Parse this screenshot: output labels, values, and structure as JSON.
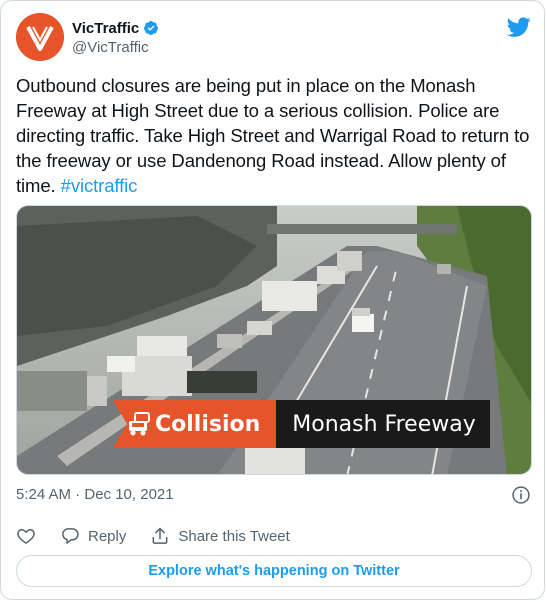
{
  "account": {
    "display_name": "VicTraffic",
    "handle": "@VicTraffic",
    "verified": true,
    "avatar_icon": "victraffic-logo",
    "brand_color": "#e8542a"
  },
  "tweet": {
    "text": "Outbound closures are being put in place on the Monash Freeway at High Street due to a serious collision.  Police are directing traffic. Take High Street and Warrigal Road to return to the freeway or use Dandenong Road instead. Allow plenty of time. ",
    "hashtag": "#victraffic",
    "timestamp": "5:24 AM · Dec 10, 2021"
  },
  "media": {
    "banner_left": "Collision",
    "banner_right": "Monash Freeway",
    "banner_left_color": "#e8542a",
    "banner_right_color": "#1a1a1a"
  },
  "actions": {
    "reply": "Reply",
    "share": "Share this Tweet"
  },
  "explore_label": "Explore what's happening on Twitter",
  "accent_color": "#1d9bf0"
}
